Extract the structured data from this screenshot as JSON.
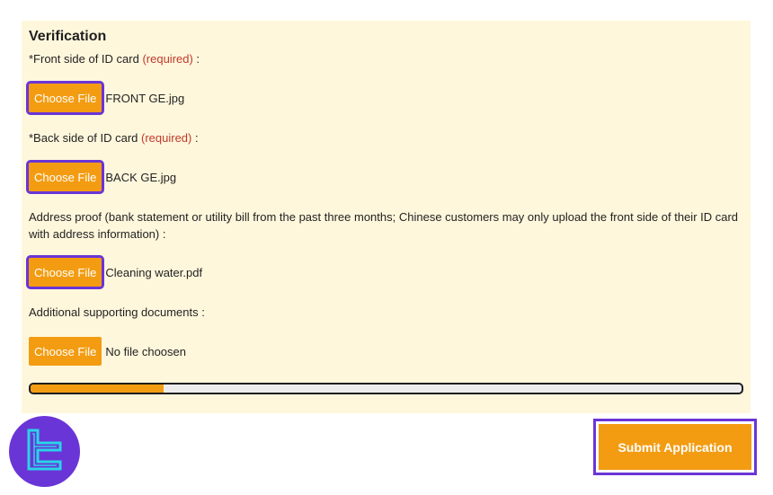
{
  "verification": {
    "title": "Verification",
    "front": {
      "label": "*Front side of ID card",
      "required": "(required)",
      "suffix": " :",
      "button": "Choose File",
      "file": "FRONT GE.jpg"
    },
    "back": {
      "label": "*Back side of ID card",
      "required": "(required)",
      "suffix": " :",
      "button": "Choose File",
      "file": "BACK GE.jpg"
    },
    "address": {
      "label": "Address proof (bank statement or utility bill from the past three months; Chinese customers may only upload the front side of their ID card with address information) :",
      "button": "Choose File",
      "file": "Cleaning water.pdf"
    },
    "additional": {
      "label": "Additional supporting documents :",
      "button": "Choose File",
      "file": "No file choosen"
    },
    "progress_percent": 18.7
  },
  "submit": {
    "label": "Submit Application"
  },
  "colors": {
    "accent": "#f39c12",
    "highlight": "#6a35d6",
    "panel_bg": "#fff7dc",
    "required": "#c0392b"
  },
  "icons": {
    "logo": "brand-logo-icon"
  }
}
